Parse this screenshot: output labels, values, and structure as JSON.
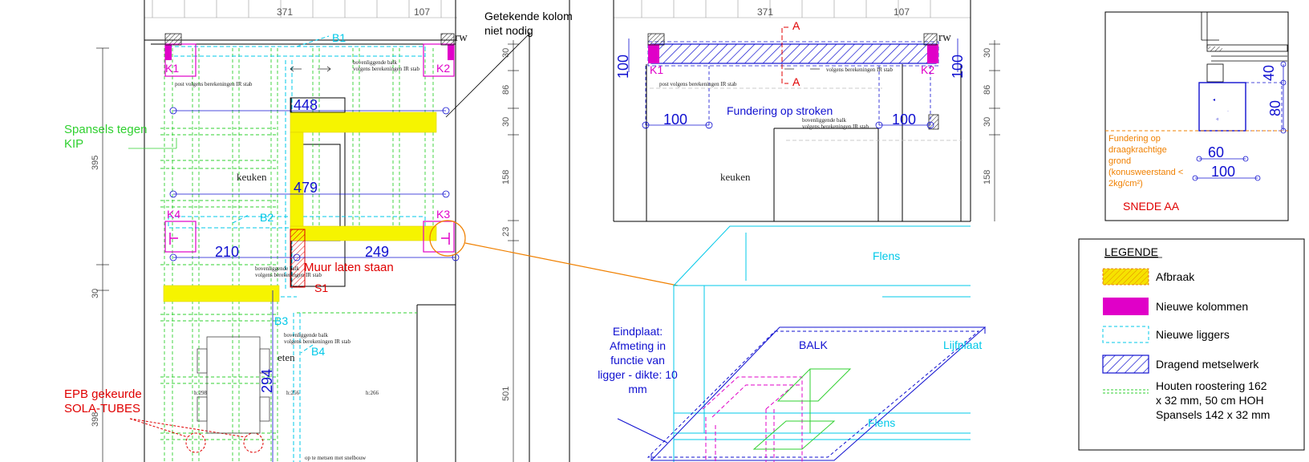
{
  "colors": {
    "blue": "#1010d0",
    "cyan": "#00c8e8",
    "magenta": "#e000c8",
    "red": "#e00000",
    "green": "#30d030",
    "orange": "#f08000",
    "yellow": "#f6f400"
  },
  "plan_left": {
    "top_dims": [
      "371",
      "107"
    ],
    "rw": "rw",
    "columns": [
      "K1",
      "K2",
      "K3",
      "K4"
    ],
    "beams": [
      "B1",
      "B2",
      "B3",
      "B4"
    ],
    "S1": "S1",
    "dims": [
      "448",
      "479",
      "210",
      "249",
      "294"
    ],
    "side_dims": [
      "30",
      "86",
      "30",
      "158",
      "23",
      "501"
    ],
    "far_dims": [
      "395",
      "30",
      "398"
    ],
    "room_labels": [
      "keuken",
      "eten"
    ],
    "note_post": "post volgens berekeningen IR stab",
    "note_balk": "bovenliggende balk",
    "note_balk2": "volgens berekeningen IR stab",
    "note_h1": "h:298",
    "note_h2": "h:256",
    "note_h3": "h:266",
    "note_bottom": "op te metsen met snelbouw",
    "callout_kolom": [
      "Getekende kolom",
      "niet nodig"
    ],
    "callout_spansels": [
      "Spansels tegen",
      "KIP"
    ],
    "callout_muur": "Muur laten staan",
    "callout_epb": [
      "EPB gekeurde",
      "SOLA-TUBES"
    ]
  },
  "plan_right": {
    "top_dims": [
      "371",
      "107"
    ],
    "rw": "rw",
    "columns": [
      "K1",
      "K2"
    ],
    "section_mark": "A",
    "dims": [
      "100",
      "100",
      "100",
      "100"
    ],
    "side_dims": [
      "30",
      "86",
      "30",
      "158"
    ],
    "foundation_label": "Fundering op stroken",
    "room_label": "keuken",
    "note_post": "post volgens berekeningen IR stab",
    "note_balk": "bovenliggende balk",
    "note_balk2": "volgens berekeningen IR stab"
  },
  "section": {
    "dims": [
      "40",
      "80",
      "60",
      "100"
    ],
    "foundation_note": [
      "Fundering op",
      "draagkrachtige",
      "grond",
      "(konusweerstand <",
      "2kg/cm²)"
    ],
    "title": "SNEDE AA"
  },
  "detail": {
    "flens_top": "Flens",
    "flens_bottom": "Flens",
    "balk": "BALK",
    "lijfplaat": "Lijfplaat",
    "eindplaat": [
      "Eindplaat:",
      "Afmeting in",
      "functie van",
      "ligger - dikte: 10",
      "mm"
    ]
  },
  "legend": {
    "title": "LEGENDE",
    "items": [
      {
        "label": "Afbraak"
      },
      {
        "label": "Nieuwe kolommen"
      },
      {
        "label": "Nieuwe liggers"
      },
      {
        "label": "Dragend metselwerk"
      },
      {
        "label": "Houten roostering 162",
        "line2": "x 32 mm, 50 cm HOH",
        "line3": "Spansels 142 x 32 mm"
      }
    ]
  }
}
